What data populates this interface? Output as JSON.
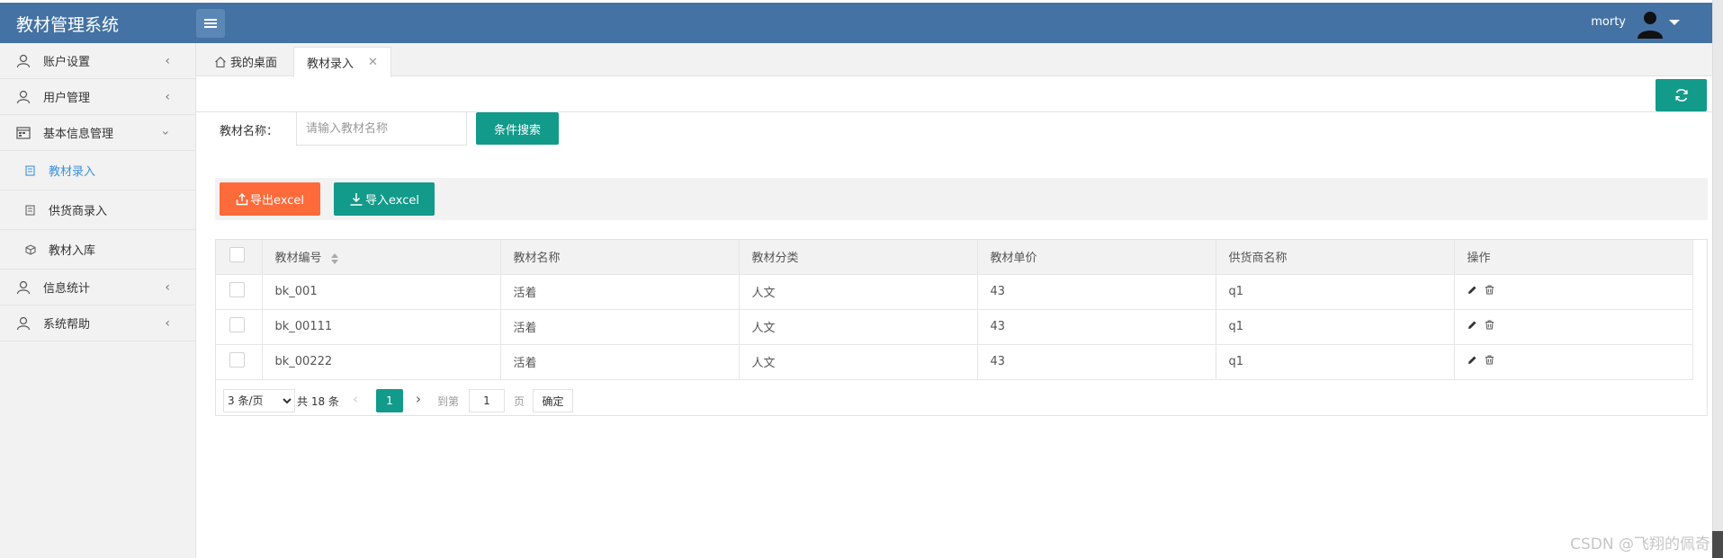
{
  "app": {
    "title": "教材管理系统"
  },
  "header": {
    "user_name": "morty"
  },
  "sidebar": {
    "items": [
      {
        "label": "账户设置",
        "icon": "user-icon"
      },
      {
        "label": "用户管理",
        "icon": "user-icon"
      },
      {
        "label": "基本信息管理",
        "icon": "calendar-icon",
        "expanded": true,
        "children": [
          {
            "label": "教材录入",
            "icon": "doc-icon",
            "active": true
          },
          {
            "label": "供货商录入",
            "icon": "doc-icon"
          },
          {
            "label": "教材入库",
            "icon": "box-icon"
          }
        ]
      },
      {
        "label": "信息统计",
        "icon": "user-icon"
      },
      {
        "label": "系统帮助",
        "icon": "user-icon"
      }
    ]
  },
  "tabs": [
    {
      "label": "我的桌面",
      "icon": "home-icon"
    },
    {
      "label": "教材录入",
      "active": true,
      "closable": true
    }
  ],
  "search": {
    "label": "教材名称：",
    "placeholder": "请输入教材名称",
    "button": "条件搜索"
  },
  "toolbar": {
    "export_label": "导出excel",
    "import_label": "导入excel",
    "export_color": "#fe6a3a",
    "import_color": "#129a8a"
  },
  "table": {
    "columns": [
      "教材编号",
      "教材名称",
      "教材分类",
      "教材单价",
      "供货商名称",
      "操作"
    ],
    "rows": [
      {
        "id": "bk_001",
        "name": "活着",
        "category": "人文",
        "price": "43",
        "supplier": "q1"
      },
      {
        "id": "bk_00111",
        "name": "活着",
        "category": "人文",
        "price": "43",
        "supplier": "q1"
      },
      {
        "id": "bk_00222",
        "name": "活着",
        "category": "人文",
        "price": "43",
        "supplier": "q1"
      }
    ]
  },
  "pagination": {
    "page_size": "3 条/页",
    "total": "共 18 条",
    "current": "1",
    "goto_label": "到第",
    "goto_value": "1",
    "page_label": "页",
    "confirm": "确定"
  },
  "watermark": "CSDN @飞翔的佩奇",
  "accent_color": "#129a8a",
  "header_color": "#4472a4"
}
